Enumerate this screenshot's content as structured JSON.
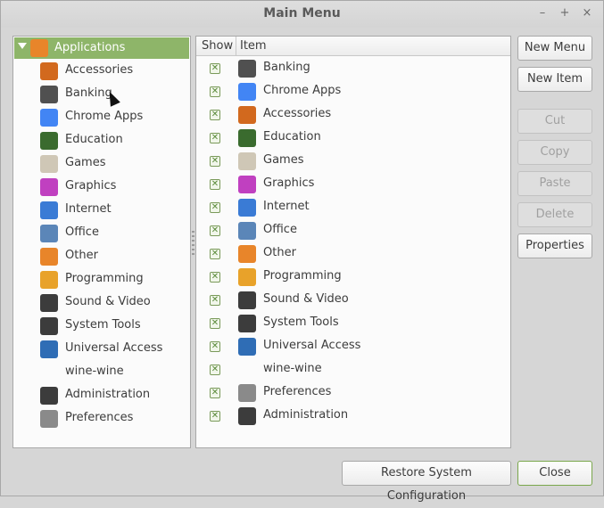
{
  "window": {
    "title": "Main Menu",
    "buttons": {
      "minimize": "–",
      "maximize": "+",
      "close": "×"
    }
  },
  "tree": {
    "root": {
      "label": "Applications",
      "icon": "applications-folder-icon",
      "color": "#e8852a"
    },
    "items": [
      {
        "label": "Accessories",
        "icon": "calculator-icon",
        "color": "#d2691e"
      },
      {
        "label": "Banking",
        "icon": "banking-icon",
        "color": "#505050"
      },
      {
        "label": "Chrome Apps",
        "icon": "chrome-icon",
        "color": "#4285f4"
      },
      {
        "label": "Education",
        "icon": "chalkboard-icon",
        "color": "#3a6b2e"
      },
      {
        "label": "Games",
        "icon": "gamepad-icon",
        "color": "#cfc7b6"
      },
      {
        "label": "Graphics",
        "icon": "palette-icon",
        "color": "#c040c0"
      },
      {
        "label": "Internet",
        "icon": "globe-icon",
        "color": "#3a7bd5"
      },
      {
        "label": "Office",
        "icon": "office-chart-icon",
        "color": "#5b86b8"
      },
      {
        "label": "Other",
        "icon": "other-folder-icon",
        "color": "#e8852a"
      },
      {
        "label": "Programming",
        "icon": "construction-icon",
        "color": "#e8a22a"
      },
      {
        "label": "Sound & Video",
        "icon": "music-icon",
        "color": "#3c3c3c"
      },
      {
        "label": "System Tools",
        "icon": "system-tools-icon",
        "color": "#3c3c3c"
      },
      {
        "label": "Universal Access",
        "icon": "accessibility-icon",
        "color": "#2f6db5"
      },
      {
        "label": "wine-wine",
        "icon": "",
        "color": ""
      },
      {
        "label": "Administration",
        "icon": "administration-gear-icon",
        "color": "#3c3c3c"
      },
      {
        "label": "Preferences",
        "icon": "sliders-icon",
        "color": "#8a8a8a"
      }
    ]
  },
  "list": {
    "headers": {
      "show": "Show",
      "item": "Item"
    },
    "check_mark": "✕",
    "items": [
      {
        "label": "Banking",
        "icon": "banking-icon",
        "color": "#505050",
        "show": true
      },
      {
        "label": "Chrome Apps",
        "icon": "chrome-icon",
        "color": "#4285f4",
        "show": true
      },
      {
        "label": "Accessories",
        "icon": "calculator-icon",
        "color": "#d2691e",
        "show": true
      },
      {
        "label": "Education",
        "icon": "chalkboard-icon",
        "color": "#3a6b2e",
        "show": true
      },
      {
        "label": "Games",
        "icon": "gamepad-icon",
        "color": "#cfc7b6",
        "show": true
      },
      {
        "label": "Graphics",
        "icon": "palette-icon",
        "color": "#c040c0",
        "show": true
      },
      {
        "label": "Internet",
        "icon": "globe-icon",
        "color": "#3a7bd5",
        "show": true
      },
      {
        "label": "Office",
        "icon": "office-chart-icon",
        "color": "#5b86b8",
        "show": true
      },
      {
        "label": "Other",
        "icon": "other-folder-icon",
        "color": "#e8852a",
        "show": true
      },
      {
        "label": "Programming",
        "icon": "construction-icon",
        "color": "#e8a22a",
        "show": true
      },
      {
        "label": "Sound & Video",
        "icon": "music-icon",
        "color": "#3c3c3c",
        "show": true
      },
      {
        "label": "System Tools",
        "icon": "system-tools-icon",
        "color": "#3c3c3c",
        "show": true
      },
      {
        "label": "Universal Access",
        "icon": "accessibility-icon",
        "color": "#2f6db5",
        "show": true
      },
      {
        "label": "wine-wine",
        "icon": "",
        "color": "",
        "show": true
      },
      {
        "label": "Preferences",
        "icon": "sliders-icon",
        "color": "#8a8a8a",
        "show": true
      },
      {
        "label": "Administration",
        "icon": "administration-gear-icon",
        "color": "#3c3c3c",
        "show": true
      }
    ]
  },
  "actions": {
    "new_menu": "New Menu",
    "new_item": "New Item",
    "cut": "Cut",
    "copy": "Copy",
    "paste": "Paste",
    "delete": "Delete",
    "properties": "Properties"
  },
  "footer": {
    "restore": "Restore System Configuration",
    "close": "Close"
  },
  "colors": {
    "selection": "#8eb569",
    "accent_border": "#7aa74c"
  }
}
